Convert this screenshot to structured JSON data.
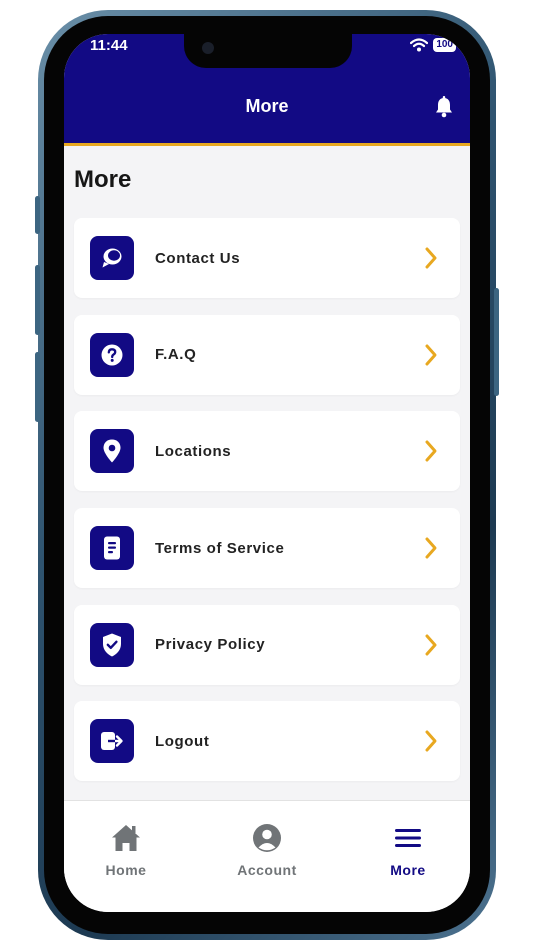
{
  "status_bar": {
    "time": "11:44",
    "battery": "100"
  },
  "header": {
    "title": "More"
  },
  "page": {
    "section_title": "More"
  },
  "menu": {
    "items": [
      {
        "label": "Contact Us",
        "icon": "chat-icon"
      },
      {
        "label": "F.A.Q",
        "icon": "question-icon"
      },
      {
        "label": "Locations",
        "icon": "location-pin-icon"
      },
      {
        "label": "Terms of Service",
        "icon": "document-icon"
      },
      {
        "label": "Privacy Policy",
        "icon": "shield-check-icon"
      },
      {
        "label": "Logout",
        "icon": "logout-icon"
      }
    ]
  },
  "tabbar": {
    "items": [
      {
        "label": "Home",
        "icon": "home-icon",
        "active": false
      },
      {
        "label": "Account",
        "icon": "account-icon",
        "active": false
      },
      {
        "label": "More",
        "icon": "menu-icon",
        "active": true
      }
    ]
  },
  "colors": {
    "brand_primary": "#120a84",
    "accent": "#e8a820",
    "background": "#f4f4f6",
    "inactive_tab": "#707477"
  }
}
